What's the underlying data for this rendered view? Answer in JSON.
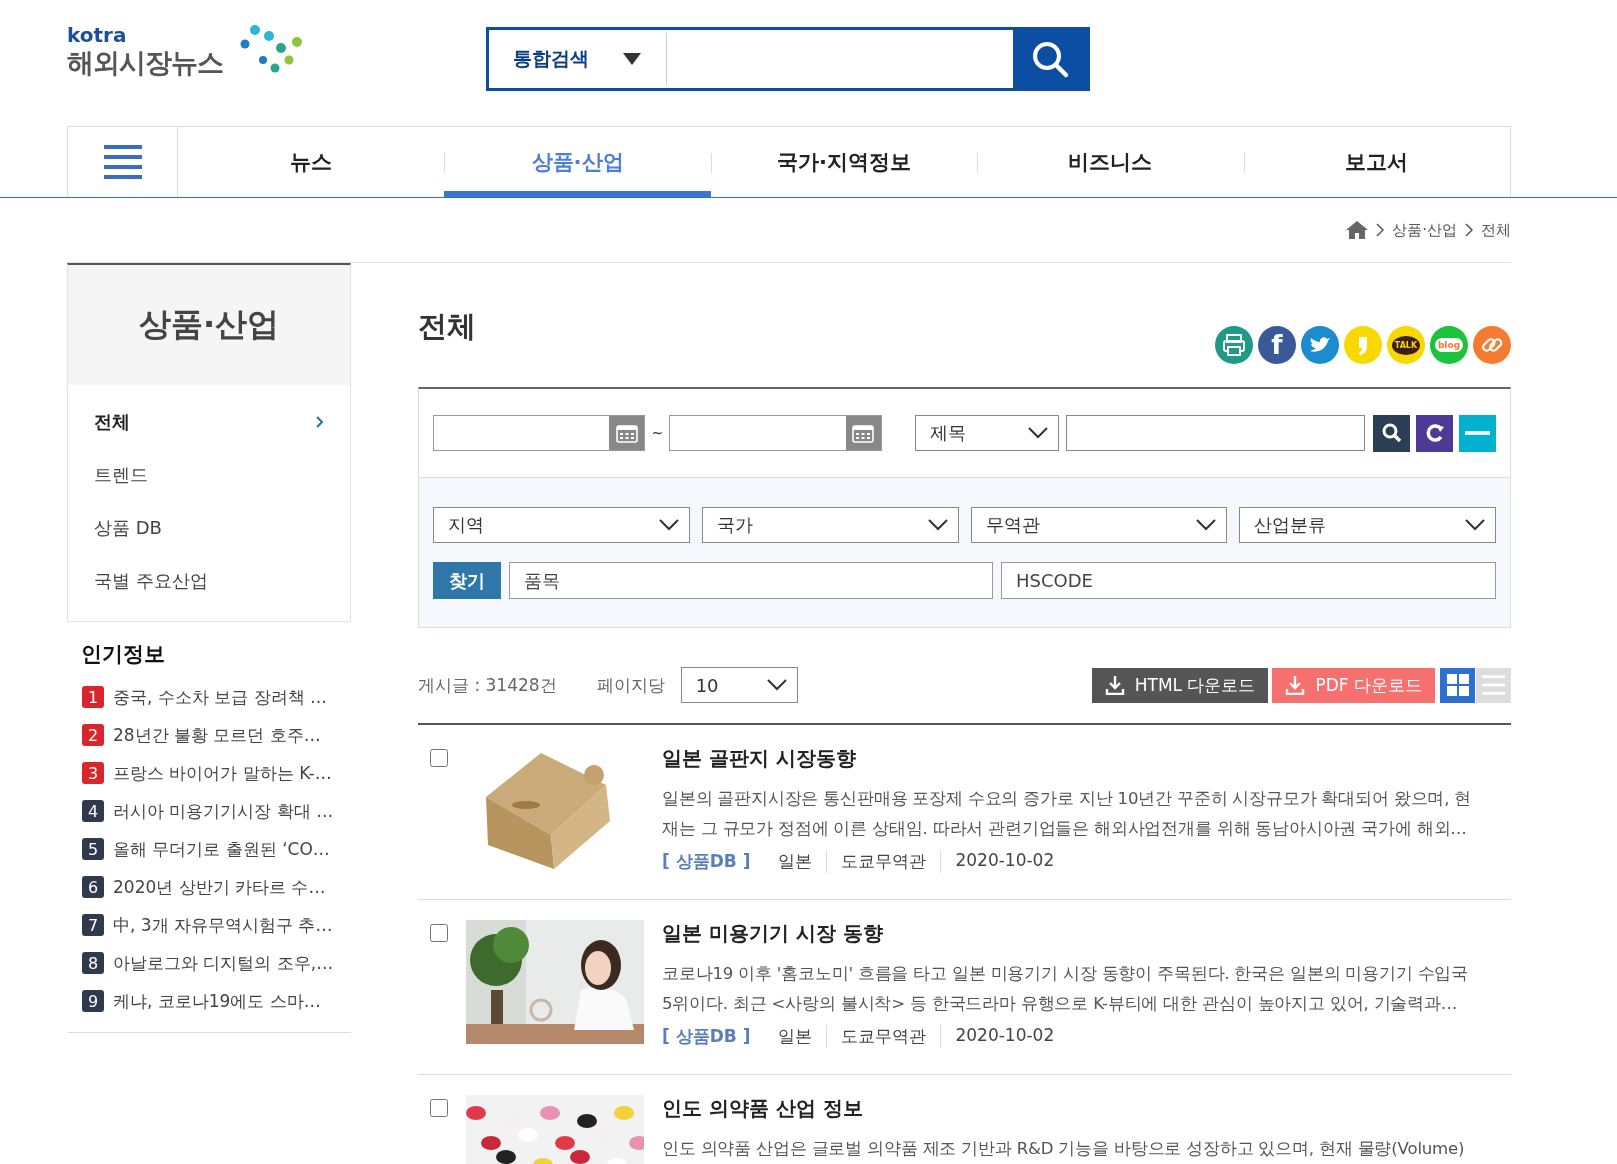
{
  "logo": {
    "brand": "kotra",
    "name": "해외시장뉴스"
  },
  "search": {
    "scope": "통합검색"
  },
  "nav": {
    "tabs": [
      {
        "label": "뉴스",
        "selected": false
      },
      {
        "label": "상품·산업",
        "selected": true
      },
      {
        "label": "국가·지역정보",
        "selected": false
      },
      {
        "label": "비즈니스",
        "selected": false
      },
      {
        "label": "보고서",
        "selected": false
      }
    ]
  },
  "breadcrumb": [
    "상품·산업",
    "전체"
  ],
  "sidebar": {
    "title": "상품·산업",
    "items": [
      {
        "label": "전체",
        "selected": true
      },
      {
        "label": "트렌드",
        "selected": false
      },
      {
        "label": "상품 DB",
        "selected": false
      },
      {
        "label": "국별 주요산업",
        "selected": false
      }
    ]
  },
  "popular": {
    "title": "인기정보",
    "items": [
      {
        "rank": "1",
        "title": "중국, 수소차 보급 장려책 …",
        "color": "#d9262c"
      },
      {
        "rank": "2",
        "title": "28년간 불황 모르던 호주…",
        "color": "#d9262c"
      },
      {
        "rank": "3",
        "title": "프랑스 바이어가 말하는 K-…",
        "color": "#d9262c"
      },
      {
        "rank": "4",
        "title": "러시아 미용기기시장 확대 …",
        "color": "#2f3b4c"
      },
      {
        "rank": "5",
        "title": "올해 무더기로 출원된 ‘CO…",
        "color": "#2f3b4c"
      },
      {
        "rank": "6",
        "title": "2020년 상반기 카타르 수…",
        "color": "#2f3b4c"
      },
      {
        "rank": "7",
        "title": "中, 3개 자유무역시험구 추…",
        "color": "#2f3b4c"
      },
      {
        "rank": "8",
        "title": "아날로그와 디지털의 조우,…",
        "color": "#2f3b4c"
      },
      {
        "rank": "9",
        "title": "케냐, 코로나19에도 스마…",
        "color": "#2f3b4c"
      }
    ]
  },
  "page_title": "전체",
  "share_buttons": [
    {
      "kind": "print"
    },
    {
      "kind": "facebook",
      "text": "f"
    },
    {
      "kind": "twitter"
    },
    {
      "kind": "story"
    },
    {
      "kind": "talk",
      "text": "TALK"
    },
    {
      "kind": "blog",
      "text": "blog"
    },
    {
      "kind": "link"
    }
  ],
  "filters": {
    "date_separator": "~",
    "field_select": "제목",
    "selects": [
      "지역",
      "국가",
      "무역관",
      "산업분류"
    ],
    "find_button": "찾기",
    "item_placeholder": "품목",
    "hscode_placeholder": "HSCODE"
  },
  "toolbar": {
    "count": "게시글 : 31428건",
    "per_page_label": "페이지당",
    "per_page": "10",
    "html_download": "HTML 다운로드",
    "pdf_download": "PDF 다운로드",
    "views": [
      {
        "kind": "grid",
        "selected": true
      },
      {
        "kind": "list",
        "selected": false
      }
    ]
  },
  "articles": [
    {
      "checked": false,
      "title": "일본 골판지 시장동향",
      "summary_lines": [
        "일본의 골판지시장은 통신판매용 포장제 수요의 증가로 지난 10년간 꾸준히 시장규모가 확대되어 왔으며, 현",
        "재는 그 규모가 정점에 이른 상태임. 따라서 관련기업들은 해외사업전개를 위해 동남아시아권 국가에 해외…"
      ],
      "category": "[ 상품DB ]",
      "country": "일본",
      "office": "도쿄무역관",
      "date": "2020-10-02"
    },
    {
      "checked": false,
      "title": "일본 미용기기 시장 동향",
      "summary_lines": [
        "코로나19 이후 '홈코노미' 흐름을 타고 일본 미용기기 시장 동향이 주목된다. 한국은 일본의 미용기기 수입국",
        "5위이다. 최근 <사랑의 불시착> 등 한국드라마 유행으로 K-뷰티에 대한 관심이 높아지고 있어, 기술력과…"
      ],
      "category": "[ 상품DB ]",
      "country": "일본",
      "office": "도쿄무역관",
      "date": "2020-10-02"
    },
    {
      "checked": false,
      "title": "인도 의약품 산업 정보",
      "summary_lines": [
        "인도 의약품 산업은 글로벌 의약품 제조 기반과 R&D 기능을 바탕으로 성장하고 있으며, 현재 물량(Volume)"
      ]
    }
  ]
}
